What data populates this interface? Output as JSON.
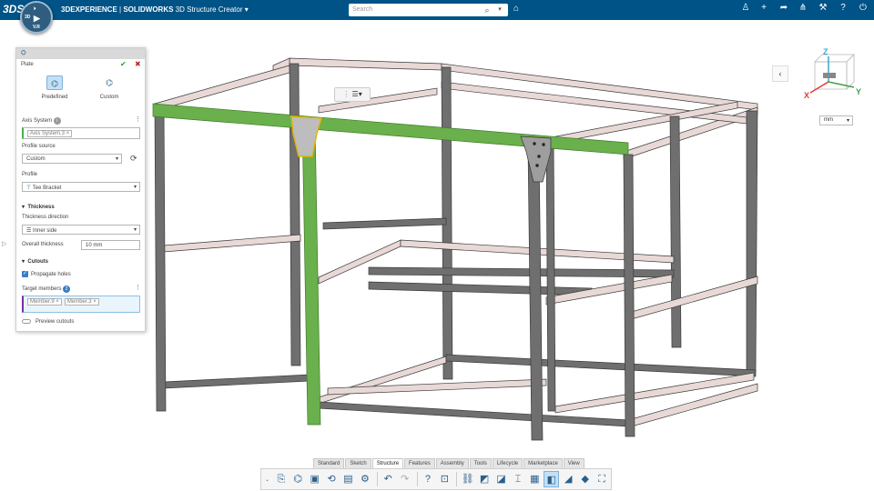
{
  "header": {
    "brand": "3DEXPERIENCE",
    "separator": " | ",
    "product": "SOLIDWORKS",
    "app": "3D Structure Creator",
    "search_placeholder": "Search",
    "compass_labels": [
      "3D",
      "V.R"
    ]
  },
  "panel": {
    "title": "Plate",
    "options": [
      {
        "label": "Predefined",
        "icon": "predefined-plate-icon"
      },
      {
        "label": "Custom",
        "icon": "custom-plate-icon"
      }
    ],
    "axis_system_label": "Axis System",
    "axis_system_value": "Axis System.3",
    "profile_source_label": "Profile source",
    "profile_source_value": "Custom",
    "profile_label": "Profile",
    "profile_value": "Tee Bracket",
    "thickness_header": "Thickness",
    "thickness_direction_label": "Thickness direction",
    "thickness_direction_value": "Inner side",
    "overall_thickness_label": "Overall thickness",
    "overall_thickness_value": "10 mm",
    "cutouts_header": "Cutouts",
    "propagate_holes_label": "Propagate holes",
    "target_members_label": "Target members",
    "target_members_count": "2",
    "target_members": [
      "Member.9",
      "Member.3"
    ],
    "preview_cutouts_label": "Preview cutouts"
  },
  "viewport": {
    "unit": "mm",
    "triad": {
      "x": "X",
      "y": "Y",
      "z": "Z"
    }
  },
  "tabs": [
    "Standard",
    "Sketch",
    "Structure",
    "Features",
    "Assembly",
    "Tools",
    "Lifecycle",
    "Marketplace",
    "View"
  ],
  "active_tab": "Structure",
  "colors": {
    "topbar": "#005386",
    "selection_green": "#6ab04c",
    "member_gray": "#6f6f6f",
    "member_pink": "#e8d9d6"
  }
}
